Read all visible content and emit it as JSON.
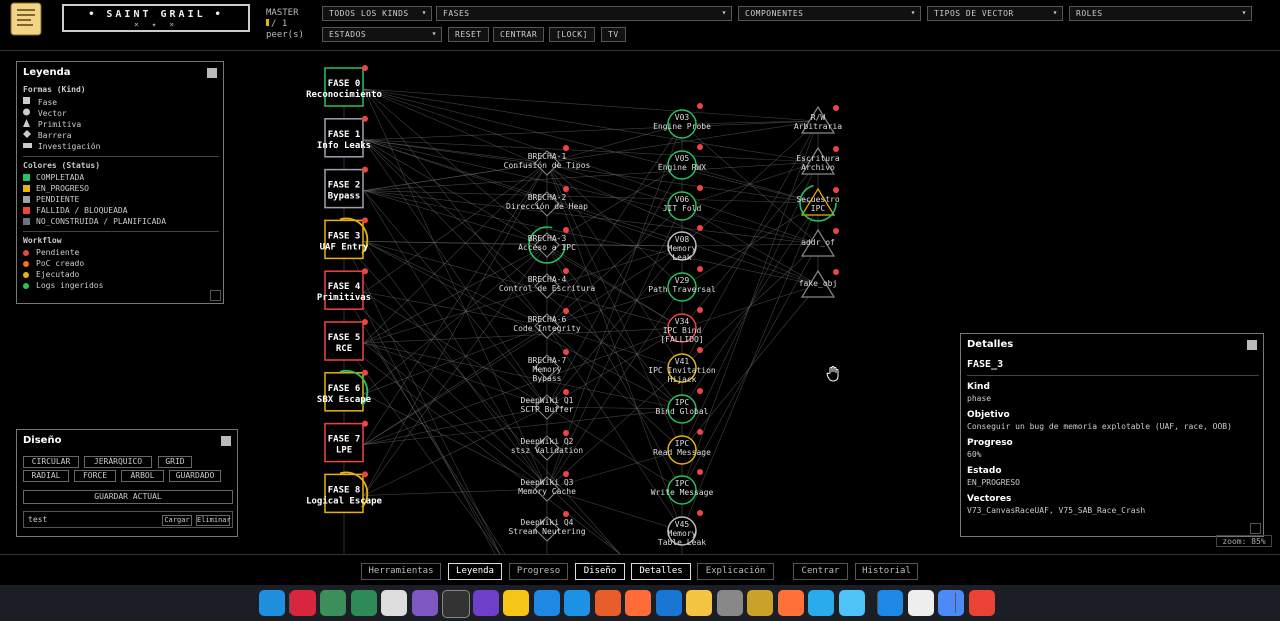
{
  "header": {
    "brand_title": "• SAINT GRAIL •",
    "brand_sub": "⨯ ✦ ⨯",
    "master_line1": "MASTER",
    "master_line2": "/ 1",
    "master_line3": "peer(s)",
    "filters": {
      "kinds": "TODOS LOS KINDS",
      "fases": "FASES",
      "componentes": "COMPONENTES",
      "tipos_vector": "TIPOS DE VECTOR",
      "roles": "ROLES",
      "estados": "ESTADOS"
    },
    "buttons": {
      "reset": "RESET",
      "centrar": "CENTRAR",
      "lock": "[LOCK]",
      "tv": "TV"
    }
  },
  "legend": {
    "title": "Leyenda",
    "shapes_title": "Formas (Kind)",
    "shapes": [
      "Fase",
      "Vector",
      "Primitiva",
      "Barrera",
      "Investigación"
    ],
    "colors_title": "Colores (Status)",
    "colors": [
      {
        "label": "COMPLETADA",
        "color": "#22c55e"
      },
      {
        "label": "EN_PROGRESO",
        "color": "#eab308"
      },
      {
        "label": "PENDIENTE",
        "color": "#9ca3af"
      },
      {
        "label": "FALLIDA / BLOQUEADA",
        "color": "#ef4444"
      },
      {
        "label": "NO_CONSTRUIDA / PLANIFICADA",
        "color": "#6b7280"
      }
    ],
    "workflow_title": "Workflow",
    "workflow": [
      {
        "label": "Pendiente",
        "color": "#ef4444"
      },
      {
        "label": "PoC creado",
        "color": "#f97316"
      },
      {
        "label": "Ejecutado",
        "color": "#eab308"
      },
      {
        "label": "Logs ingeridos",
        "color": "#22c55e"
      }
    ]
  },
  "layout_panel": {
    "title": "Diseño",
    "buttons": [
      "CIRCULAR",
      "JERÁRQUICO",
      "GRID",
      "RADIAL",
      "FORCE",
      "ÁRBOL",
      "GUARDADO"
    ],
    "save": "GUARDAR ACTUAL",
    "input_value": "test",
    "load": "Cargar",
    "delete": "Eliminar"
  },
  "phases": [
    {
      "l1": "FASE 0",
      "l2": "Reconocimiento",
      "color": "#22c55e"
    },
    {
      "l1": "FASE 1",
      "l2": "Info Leaks",
      "color": "#9ca3af"
    },
    {
      "l1": "FASE 2",
      "l2": "Bypass",
      "color": "#9ca3af"
    },
    {
      "l1": "FASE 3",
      "l2": "UAF Entry",
      "color": "#eab308"
    },
    {
      "l1": "FASE 4",
      "l2": "Primitivas",
      "color": "#ef4444"
    },
    {
      "l1": "FASE 5",
      "l2": "RCE",
      "color": "#ef4444"
    },
    {
      "l1": "FASE 6",
      "l2": "SBX Escape",
      "color": "#eab308"
    },
    {
      "l1": "FASE 7",
      "l2": "LPE",
      "color": "#ef4444"
    },
    {
      "l1": "FASE 8",
      "l2": "Logical Escape",
      "color": "#eab308"
    }
  ],
  "barriers": [
    [
      "BRECHA-1",
      "Confusión de Tipos"
    ],
    [
      "BRECHA-2",
      "Dirección de Heap"
    ],
    [
      "BRECHA-3",
      "Acceso a IPC"
    ],
    [
      "BRECHA-4",
      "Control de Escritura"
    ],
    [
      "BRECHA-6",
      "Code Integrity"
    ],
    [
      "BRECHA-7",
      "Memory",
      "Bypass"
    ],
    [
      "DeepWiki Q1",
      "SCTP Buffer"
    ],
    [
      "DeepWiki Q2",
      "stsz Validation"
    ],
    [
      "DeepWiki Q3",
      "Memory Cache"
    ],
    [
      "DeepWiki Q4",
      "Stream Neutering"
    ]
  ],
  "vectors": [
    [
      "V03",
      "Engine Probe"
    ],
    [
      "V05",
      "Engine RWX"
    ],
    [
      "V06",
      "JIT Fold"
    ],
    [
      "V08",
      "Memory",
      "Leak"
    ],
    [
      "V29",
      "Path Traversal"
    ],
    [
      "V34",
      "IPC Bind",
      "[FALLIDO]"
    ],
    [
      "V41",
      "IPC Invitation",
      "Hijack"
    ],
    [
      "IPC",
      "Bind Global"
    ],
    [
      "IPC",
      "Read Message"
    ],
    [
      "IPC",
      "Write Message"
    ],
    [
      "V45",
      "Memory",
      "Table Leak"
    ]
  ],
  "primitives": [
    [
      "R/W",
      "Arbitraria"
    ],
    [
      "Escritura",
      "Archivo"
    ],
    [
      "Secuestro",
      "IPC"
    ],
    [
      "addr_of"
    ],
    [
      "fake_obj"
    ]
  ],
  "details": {
    "title": "Detalles",
    "node_id": "FASE_3",
    "kind_label": "Kind",
    "kind": "phase",
    "objetivo_label": "Objetivo",
    "objetivo": "Conseguir un bug de memoria explotable (UAF, race, OOB)",
    "progreso_label": "Progreso",
    "progreso": "60%",
    "estado_label": "Estado",
    "estado": "EN_PROGRESO",
    "vectores_label": "Vectores",
    "vectores": "V73_CanvasRaceUAF, V75_SAB_Race_Crash"
  },
  "zoom": "zoom: 85%",
  "toolbar": [
    "Herramientas",
    "Leyenda",
    "Progreso",
    "Diseño",
    "Detalles",
    "Explicación",
    "Centrar",
    "Historial"
  ],
  "toolbar_active": [
    "Leyenda",
    "Diseño",
    "Detalles"
  ],
  "dock_apps": [
    "workspace-icon",
    "debian-icon",
    "ai-icon",
    "ai2-icon",
    "disk-icon",
    "ghost-icon",
    "terminal-icon",
    "github-icon",
    "notes-icon",
    "vscode-icon",
    "docker-icon",
    "ax-icon",
    "postman-icon",
    "book-icon",
    "python-icon",
    "vm-icon",
    "hiero-icon",
    "firefox-icon",
    "telegram-icon",
    "search-icon",
    "files-icon",
    "clipboard-icon",
    "chromium-icon",
    "chrome-icon"
  ]
}
